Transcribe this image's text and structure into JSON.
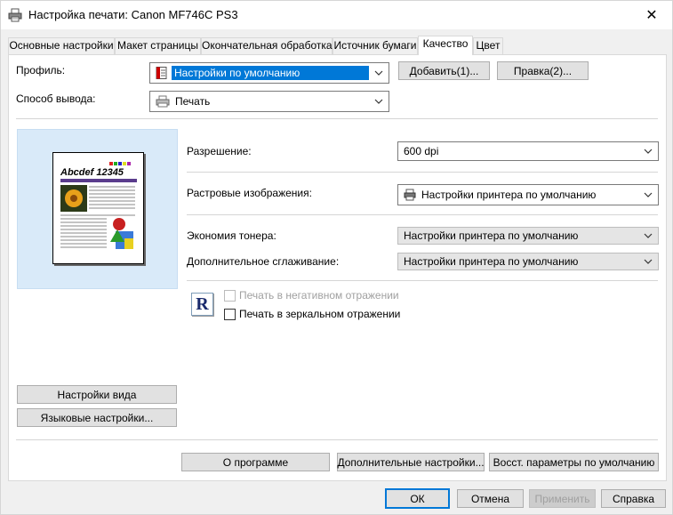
{
  "window": {
    "title": "Настройка печати: Canon MF746C PS3",
    "close_symbol": "✕"
  },
  "tabs": [
    {
      "label": "Основные настройки"
    },
    {
      "label": "Макет страницы"
    },
    {
      "label": "Окончательная обработка"
    },
    {
      "label": "Источник бумаги"
    },
    {
      "label": "Качество",
      "active": true
    },
    {
      "label": "Цвет"
    }
  ],
  "profile": {
    "label": "Профиль:",
    "value": "Настройки по умолчанию",
    "add_button": "Добавить(1)...",
    "edit_button": "Правка(2)..."
  },
  "output": {
    "label": "Способ вывода:",
    "value": "Печать"
  },
  "preview": {
    "heading": "Abcdef 12345"
  },
  "resolution": {
    "label": "Разрешение:",
    "value": "600 dpi"
  },
  "raster": {
    "label": "Растровые изображения:",
    "value": "Настройки принтера по умолчанию"
  },
  "toner": {
    "label": "Экономия тонера:",
    "value": "Настройки принтера по умолчанию"
  },
  "smoothing": {
    "label": "Дополнительное сглаживание:",
    "value": "Настройки принтера по умолчанию"
  },
  "checks": {
    "r_icon": "R",
    "negative": "Печать в негативном отражении",
    "mirror": "Печать в зеркальном отражении"
  },
  "left_buttons": {
    "view_settings": "Настройки вида",
    "language_settings": "Языковые настройки..."
  },
  "bottom_buttons": {
    "about": "О программе",
    "advanced": "Дополнительные настройки...",
    "restore": "Восст. параметры по умолчанию"
  },
  "dialog_buttons": {
    "ok": "ОК",
    "cancel": "Отмена",
    "apply": "Применить",
    "help": "Справка"
  }
}
